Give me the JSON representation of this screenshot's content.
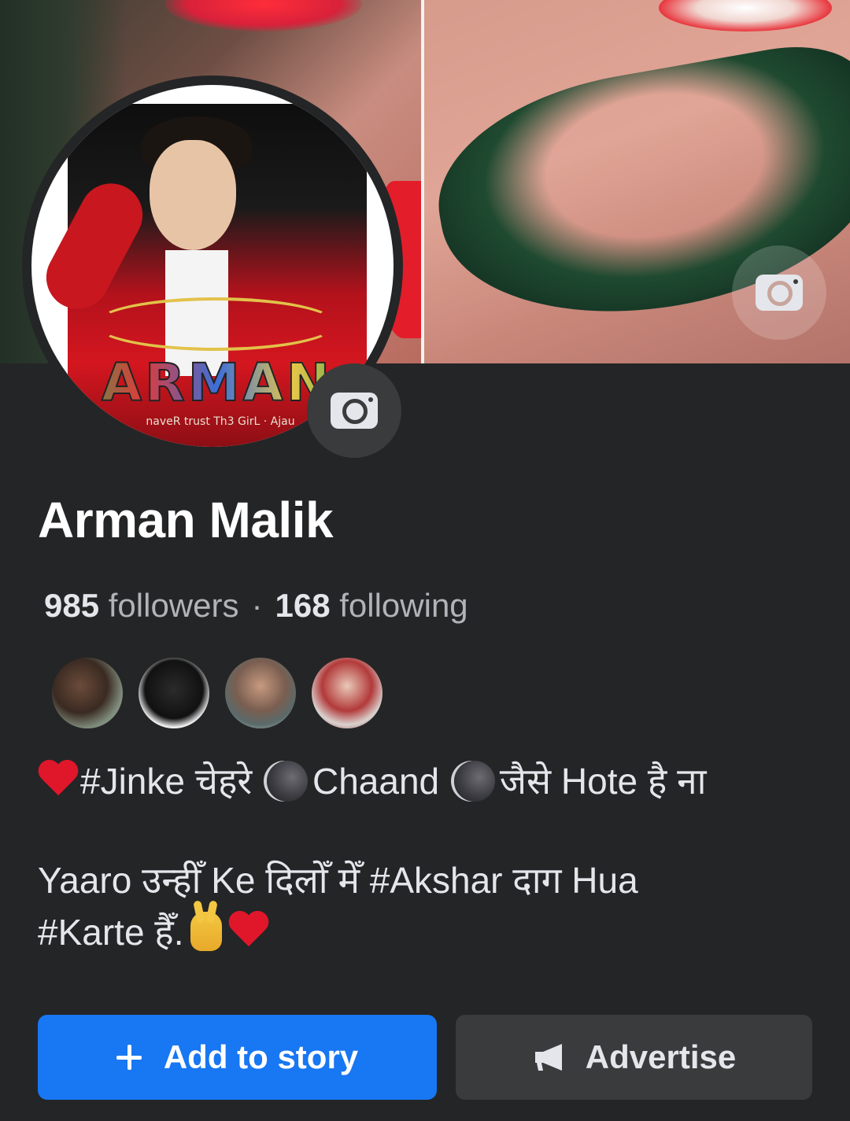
{
  "profile": {
    "name": "Arman Malik",
    "avatar_logo_text": "ARMAN",
    "avatar_tagline": "naveR trust Th3 GirL · Ajau"
  },
  "stats": {
    "followers_count": "985",
    "followers_label": "followers",
    "separator": "·",
    "following_count": "168",
    "following_label": "following"
  },
  "mutual_friends": [
    {
      "icon": "friend-avatar-1"
    },
    {
      "icon": "friend-avatar-2"
    },
    {
      "icon": "friend-avatar-3"
    },
    {
      "icon": "friend-avatar-4"
    }
  ],
  "bio": {
    "line1_part1": "#Jinke चेहरे",
    "line1_part2": "Chaand",
    "line1_part3": "जैसे Hote है ना",
    "line2": "Yaaro उन्हीँ Ke दिलोँ मेँ #Akshar दाग Hua",
    "line3": "#Karte हैँ."
  },
  "actions": {
    "add_story_label": "Add to story",
    "advertise_label": "Advertise"
  },
  "colors": {
    "background": "#242526",
    "primary_button": "#1877f2",
    "secondary_button": "#3a3b3c",
    "text": "#e4e6eb",
    "muted_text": "#b0b3b8"
  }
}
